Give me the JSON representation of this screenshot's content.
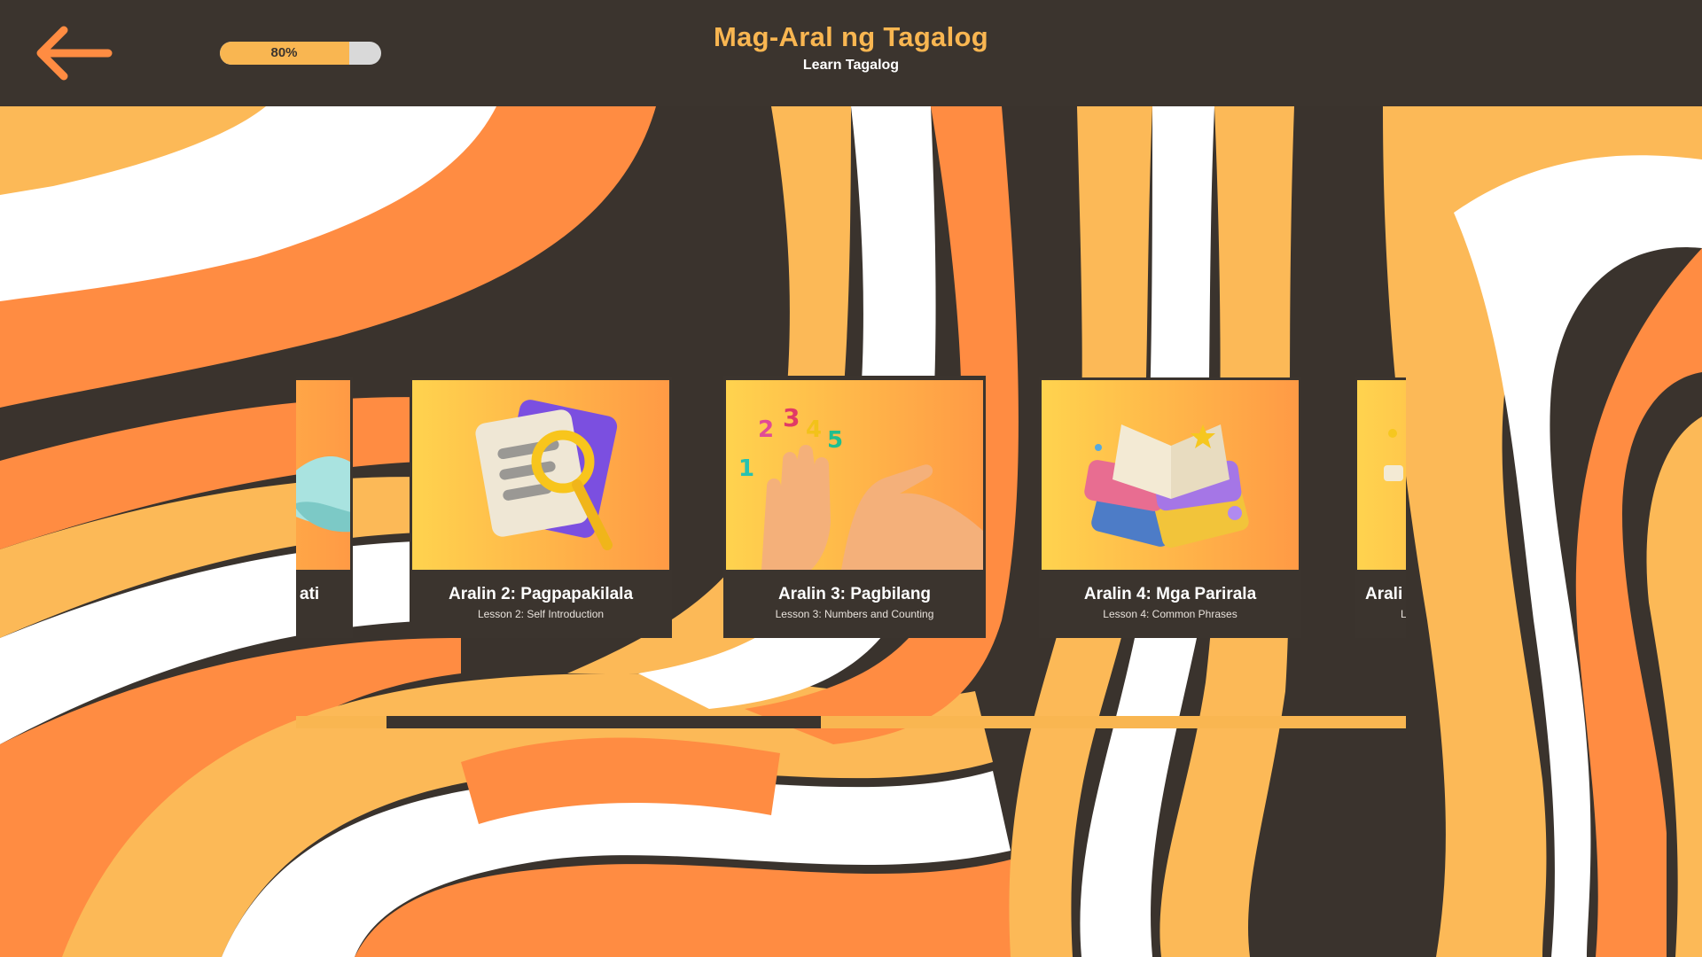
{
  "header": {
    "title": "Mag-Aral ng Tagalog",
    "subtitle": "Learn Tagalog",
    "back_icon": "arrow-left-icon",
    "progress": {
      "percent": 80,
      "label": "80%"
    }
  },
  "lessons": [
    {
      "title": "ati",
      "subtitle": "",
      "icon": "hand-icon"
    },
    {
      "title": "Aralin 2: Pagpapakilala",
      "subtitle": "Lesson 2: Self Introduction",
      "icon": "magnifier-documents-icon"
    },
    {
      "title": "Aralin 3: Pagbilang",
      "subtitle": "Lesson 3: Numbers and Counting",
      "icon": "counting-fingers-icon"
    },
    {
      "title": "Aralin 4: Mga Parirala",
      "subtitle": "Lesson 4: Common Phrases",
      "icon": "open-books-icon"
    },
    {
      "title": "Arali",
      "subtitle": "L",
      "icon": "lesson-icon"
    }
  ],
  "colors": {
    "dark": "#3b342e",
    "orange": "#ff8c42",
    "light_orange": "#fcb957",
    "white": "#ffffff",
    "accent": "#f9b651"
  }
}
